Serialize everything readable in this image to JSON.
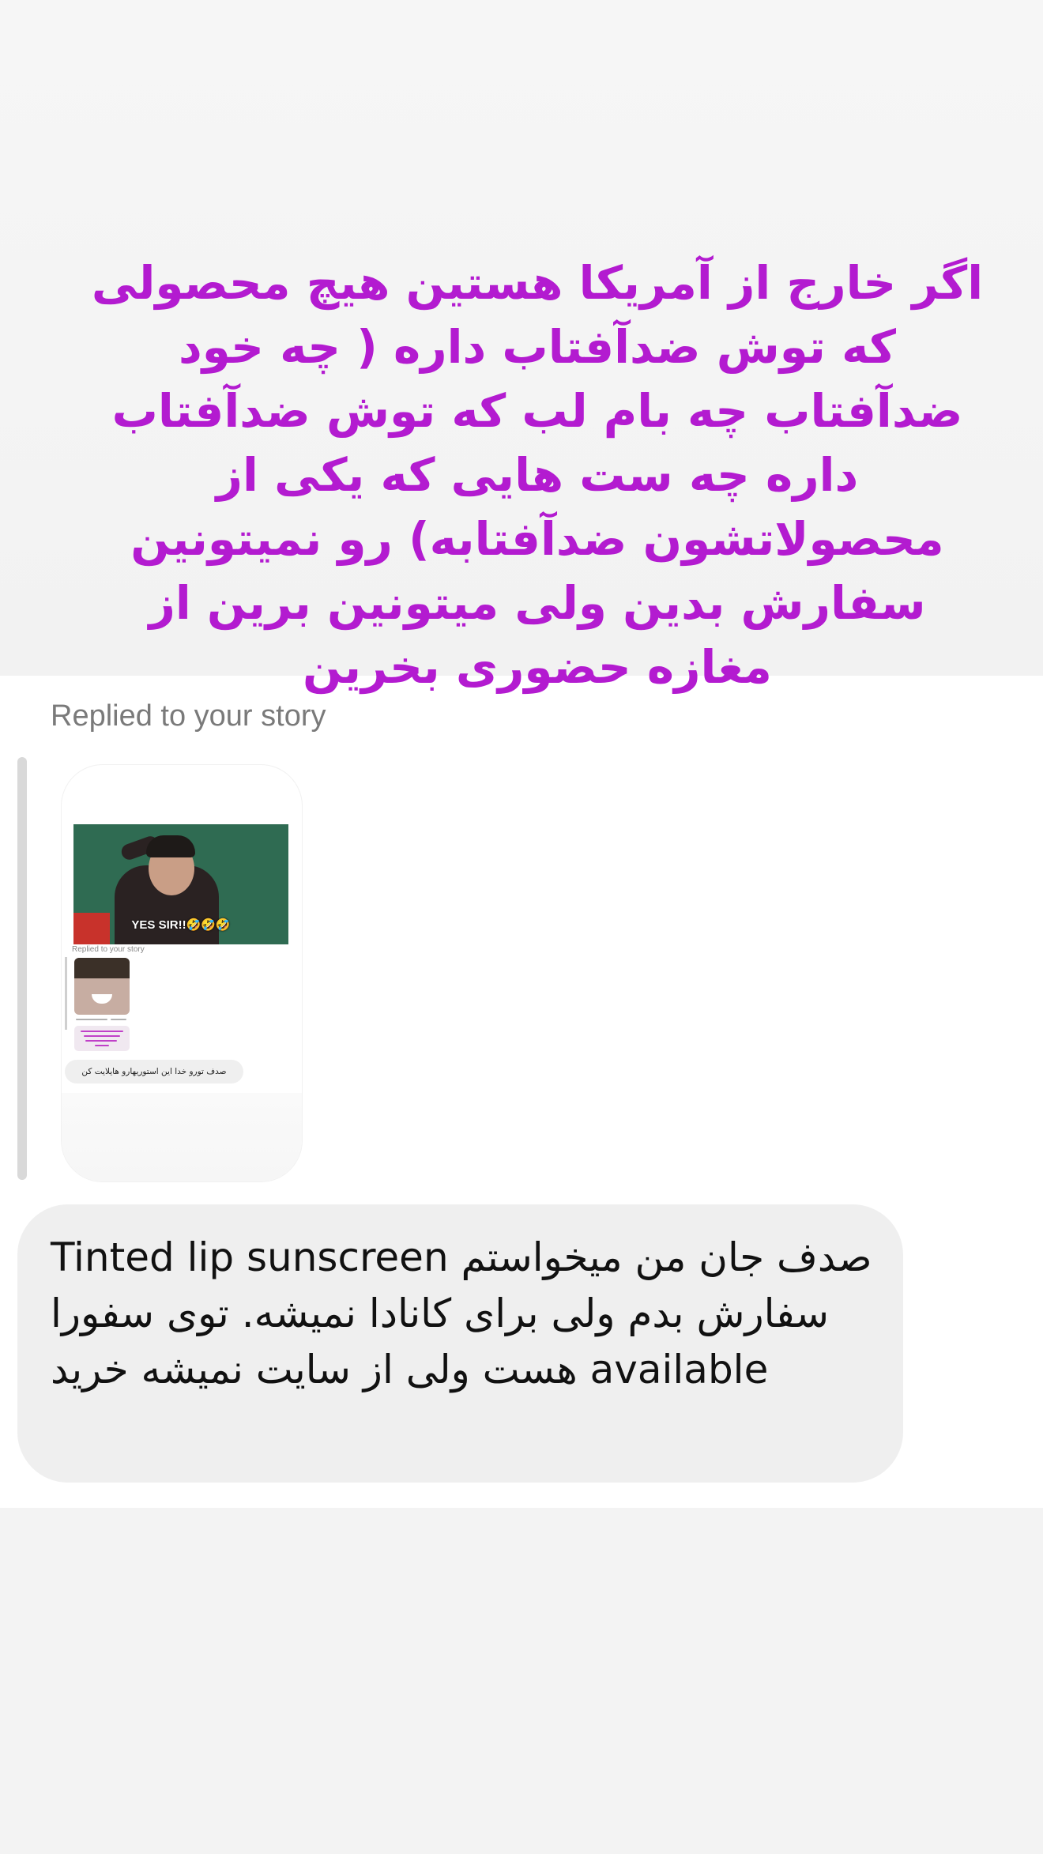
{
  "story_overlay": {
    "text": "اگر خارج از آمریکا هستین هیچ محصولی که توش ضدآفتاب داره ( چه خود ضدآفتاب چه بام لب که توش ضدآفتاب داره چه ست هایی که یکی از محصولاتشون ضدآفتابه) رو نمیتونین سفارش بدین ولی میتونین برین از مغازه حضوری بخرین"
  },
  "reply_header": {
    "label": "Replied to your story"
  },
  "story_preview": {
    "gif_caption": "YES SIR!!🤣🤣🤣",
    "mini_replied_label": "Replied to your story",
    "mini_message": "صدف تورو خدا این استوریهارو هایلایت کن"
  },
  "message": {
    "text": "صدف جان من میخواستم Tinted lip sunscreen سفارش بدم ولی برای کانادا نمیشه. توی سفورا available هست ولی از سایت نمیشه خرید"
  },
  "colors": {
    "overlay_text": "#b31bd0",
    "bubble_background": "#efefef",
    "reply_label": "#7a7a7a"
  }
}
